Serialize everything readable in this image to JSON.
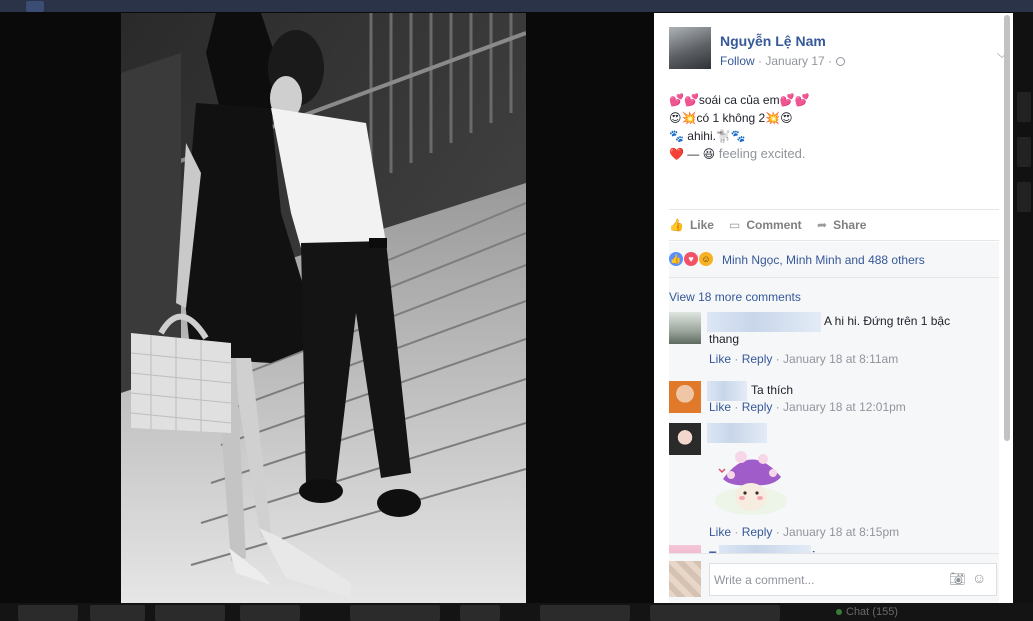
{
  "background": {
    "chat_label": "Chat (155)"
  },
  "post": {
    "author": "Nguyễn Lệ Nam",
    "follow_label": "Follow",
    "separator": " · ",
    "date": "January 17",
    "lines": [
      "💕💕soái ca của em💕💕",
      "😍💥có 1 không 2💥😍",
      "🐾 ahihi.🐩🐾"
    ],
    "feeling_prefix": "❤️ — 😆",
    "feeling_text": " feeling excited."
  },
  "actions": {
    "like": "Like",
    "comment": "Comment",
    "share": "Share"
  },
  "reactions": {
    "names": "Minh Ngọc, Minh Minh and 488 others",
    "colors": {
      "like": "#5890ff",
      "love": "#f25268",
      "haha": "#f7b125"
    }
  },
  "comments": {
    "view_more": "View 18 more comments",
    "items": [
      {
        "text_line1": "A hi hi. Đứng trên 1 bậc",
        "text_line2": "thang",
        "like": "Like",
        "reply": "Reply",
        "time": "January 18 at 8:11am"
      },
      {
        "text": "Ta thích",
        "like": "Like",
        "reply": "Reply",
        "time": "January 18 at 12:01pm"
      },
      {
        "sticker": "mushroom-sticker",
        "like": "Like",
        "reply": "Reply",
        "time": "January 18 at 8:15pm"
      },
      {
        "name_start": "Tr",
        "name_end": "ic"
      }
    ]
  },
  "composer": {
    "placeholder": "Write a comment..."
  }
}
